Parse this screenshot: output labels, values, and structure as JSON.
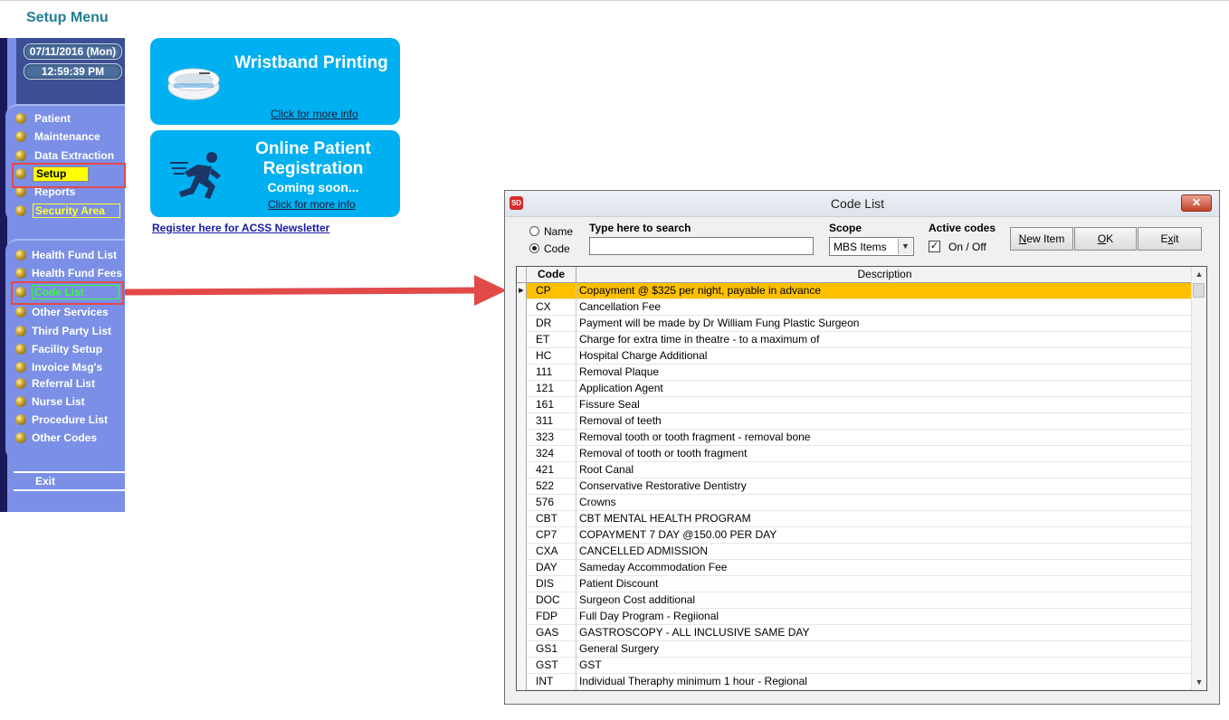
{
  "page": {
    "title": "Setup Menu"
  },
  "clock": {
    "date": "07/11/2016 (Mon)",
    "time": "12:59:39 PM"
  },
  "sidebar": {
    "main_items": [
      "Patient",
      "Maintenance",
      "Data Extraction",
      "Setup",
      "Reports",
      "Security Area"
    ],
    "setup_items": [
      "Health Fund List",
      "Health Fund Fees",
      "Code List",
      "Other Services",
      "Third Party List",
      "Facility Setup",
      "Invoice Msg's",
      "Referral List",
      "Nurse List",
      "Procedure List",
      "Other Codes"
    ],
    "exit_label": "Exit"
  },
  "cards": {
    "wristband": {
      "title": "Wristband Printing",
      "link": "Click for more info"
    },
    "registration": {
      "title_line1": "Online Patient",
      "title_line2": "Registration",
      "subtitle": "Coming soon...",
      "link": "Click for more info"
    },
    "newsletter_link": "Register here for ACSS Newsletter"
  },
  "dialog": {
    "app_icon": "SD",
    "title": "Code List",
    "close_label": "✕",
    "radio_name": "Name",
    "radio_code": "Code",
    "search_label": "Type here to search",
    "search_value": "",
    "scope_label": "Scope",
    "scope_value": "MBS Items",
    "active_label": "Active codes",
    "active_toggle": "On / Off",
    "btn_new": "New Item",
    "btn_ok": "OK",
    "btn_exit": "Exit",
    "columns": {
      "code": "Code",
      "description": "Description"
    },
    "rows": [
      {
        "code": "CP",
        "desc": "Copayment @ $325 per night, payable in advance"
      },
      {
        "code": "CX",
        "desc": "Cancellation Fee"
      },
      {
        "code": "DR",
        "desc": "Payment will be made by Dr William Fung Plastic Surgeon"
      },
      {
        "code": "ET",
        "desc": "Charge for extra time in theatre - to a maximum of"
      },
      {
        "code": "HC",
        "desc": "Hospital Charge Additional"
      },
      {
        "code": "111",
        "desc": "Removal Plaque"
      },
      {
        "code": "121",
        "desc": "Application Agent"
      },
      {
        "code": "161",
        "desc": "Fissure Seal"
      },
      {
        "code": "311",
        "desc": "Removal of teeth"
      },
      {
        "code": "323",
        "desc": "Removal tooth or tooth fragment - removal bone"
      },
      {
        "code": "324",
        "desc": "Removal of tooth or tooth fragment"
      },
      {
        "code": "421",
        "desc": "Root Canal"
      },
      {
        "code": "522",
        "desc": "Conservative Restorative Dentistry"
      },
      {
        "code": "576",
        "desc": "Crowns"
      },
      {
        "code": "CBT",
        "desc": "CBT MENTAL HEALTH PROGRAM"
      },
      {
        "code": "CP7",
        "desc": "COPAYMENT 7 DAY @150.00 PER DAY"
      },
      {
        "code": "CXA",
        "desc": "CANCELLED ADMISSION"
      },
      {
        "code": "DAY",
        "desc": "Sameday Accommodation Fee"
      },
      {
        "code": "DIS",
        "desc": "Patient Discount"
      },
      {
        "code": "DOC",
        "desc": "Surgeon Cost additional"
      },
      {
        "code": "FDP",
        "desc": "Full Day Program - Regiional"
      },
      {
        "code": "GAS",
        "desc": "GASTROSCOPY - ALL INCLUSIVE SAME DAY"
      },
      {
        "code": "GS1",
        "desc": "General Surgery"
      },
      {
        "code": "GST",
        "desc": "GST"
      },
      {
        "code": "INT",
        "desc": "Individual Theraphy minimum 1 hour - Regional"
      }
    ]
  },
  "colors": {
    "accent": "#00b0f0",
    "selected_row": "#ffc000",
    "sidebar": "#7b8fe6",
    "arrow": "#e24a4a"
  }
}
